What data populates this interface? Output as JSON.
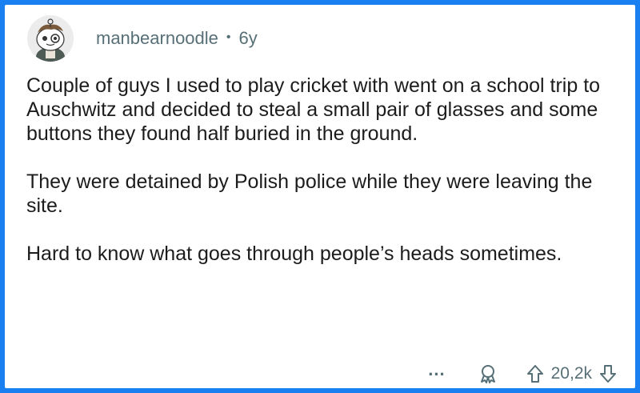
{
  "comment": {
    "author": "manbearnoodle",
    "separator": "•",
    "age": "6y",
    "paragraphs": [
      "Couple of guys I used to play cricket with went on a school trip to Auschwitz and decided to steal a small pair of glasses and some buttons they found half buried in the ground.",
      "They were detained by Polish police while they were leaving the site.",
      "Hard to know what goes through people’s heads sometimes."
    ]
  },
  "actions": {
    "more_label": "...",
    "score": "20,2k",
    "icons": {
      "avatar": "snoo-avatar",
      "award": "award-icon",
      "upvote": "upvote-arrow-icon",
      "downvote": "downvote-arrow-icon"
    }
  },
  "colors": {
    "border": "#1a7ff0",
    "meta": "#576f76",
    "text": "#1c1c1c"
  }
}
